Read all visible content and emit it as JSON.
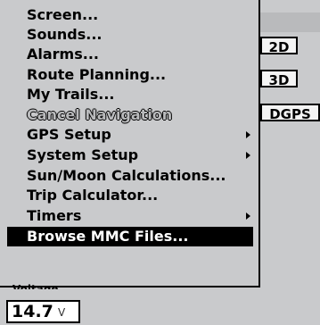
{
  "menu": {
    "items": [
      {
        "label": "Screen...",
        "submenu": false,
        "disabled": false,
        "selected": false
      },
      {
        "label": "Sounds...",
        "submenu": false,
        "disabled": false,
        "selected": false
      },
      {
        "label": "Alarms...",
        "submenu": false,
        "disabled": false,
        "selected": false
      },
      {
        "label": "Route Planning...",
        "submenu": false,
        "disabled": false,
        "selected": false
      },
      {
        "label": "My Trails...",
        "submenu": false,
        "disabled": false,
        "selected": false
      },
      {
        "label": "Cancel Navigation",
        "submenu": false,
        "disabled": true,
        "selected": false
      },
      {
        "label": "GPS Setup",
        "submenu": true,
        "disabled": false,
        "selected": false
      },
      {
        "label": "System Setup",
        "submenu": true,
        "disabled": false,
        "selected": false
      },
      {
        "label": "Sun/Moon Calculations...",
        "submenu": false,
        "disabled": false,
        "selected": false
      },
      {
        "label": "Trip Calculator...",
        "submenu": false,
        "disabled": false,
        "selected": false
      },
      {
        "label": "Timers",
        "submenu": true,
        "disabled": false,
        "selected": false
      },
      {
        "label": "Browse MMC Files...",
        "submenu": false,
        "disabled": false,
        "selected": true
      }
    ]
  },
  "status_buttons": {
    "mode_2d": "2D",
    "mode_3d": "3D",
    "dgps": "DGPS"
  },
  "voltage": {
    "label": "Voltage",
    "value": "14.7",
    "unit": "V"
  },
  "colors": {
    "background": "#c9cacc",
    "selection": "#000000",
    "selected_text": "#ffffff",
    "disabled_text": "#b9babc"
  },
  "icons": {
    "submenu_arrow": "chevron-right-icon"
  }
}
